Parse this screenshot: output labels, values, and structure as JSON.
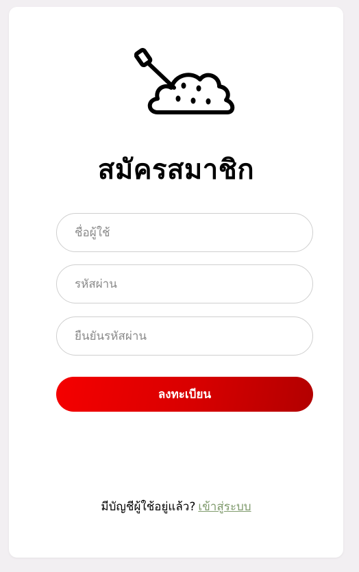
{
  "register": {
    "title": "สมัครสมาชิก",
    "username_placeholder": "ชื่อผู้ใช้",
    "password_placeholder": "รหัสผ่าน",
    "confirm_placeholder": "ยืนยันรหัสผ่าน",
    "submit_label": "ลงทะเบียน",
    "footer_text": "มีบัญชีผู้ใช้อยู่แล้ว?",
    "login_link": "เข้าสู่ระบบ"
  },
  "icons": {
    "logo": "shovel-dirt-icon"
  },
  "colors": {
    "accent_start": "#f50000",
    "accent_end": "#b20000",
    "link": "#7f9a6c"
  }
}
